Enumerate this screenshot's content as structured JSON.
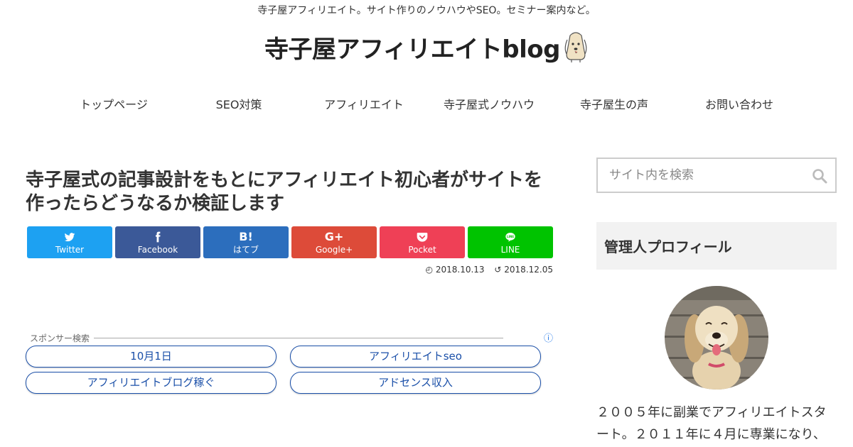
{
  "header": {
    "tagline": "寺子屋アフィリエイト。サイト作りのノウハウやSEO。セミナー案内など。",
    "logo_text": "寺子屋アフィリエイトblog"
  },
  "nav": {
    "items": [
      {
        "label": "トップページ"
      },
      {
        "label": "SEO対策"
      },
      {
        "label": "アフィリエイト"
      },
      {
        "label": "寺子屋式ノウハウ"
      },
      {
        "label": "寺子屋生の声"
      },
      {
        "label": "お問い合わせ"
      }
    ]
  },
  "article": {
    "title": "寺子屋式の記事設計をもとにアフィリエイト初心者がサイトを作ったらどうなるか検証します",
    "published": "2018.10.13",
    "updated": "2018.12.05"
  },
  "share": {
    "buttons": [
      {
        "label": "Twitter",
        "icon": "twitter-icon",
        "color": "#1da1f2"
      },
      {
        "label": "Facebook",
        "icon": "facebook-icon",
        "color": "#3b5998"
      },
      {
        "label": "はてブ",
        "icon": "hatena-icon",
        "glyph": "B!",
        "color": "#2c6ebd"
      },
      {
        "label": "Google+",
        "icon": "google-plus-icon",
        "glyph": "G+",
        "color": "#dd4b39"
      },
      {
        "label": "Pocket",
        "icon": "pocket-icon",
        "color": "#ef4056"
      },
      {
        "label": "LINE",
        "icon": "line-icon",
        "color": "#00c300"
      }
    ]
  },
  "sponsor": {
    "title": "スポンサー検索",
    "info_icon": "info-icon",
    "links": [
      {
        "label": "10月1日"
      },
      {
        "label": "アフィリエイトseo"
      },
      {
        "label": "アフィリエイトブログ稼ぐ"
      },
      {
        "label": "アドセンス収入"
      }
    ]
  },
  "sidebar": {
    "search_placeholder": "サイト内を検索",
    "profile_heading": "管理人プロフィール",
    "bio": "２００５年に副業でアフィリエイトスタート。２０１１年に４月に専業になり、"
  }
}
